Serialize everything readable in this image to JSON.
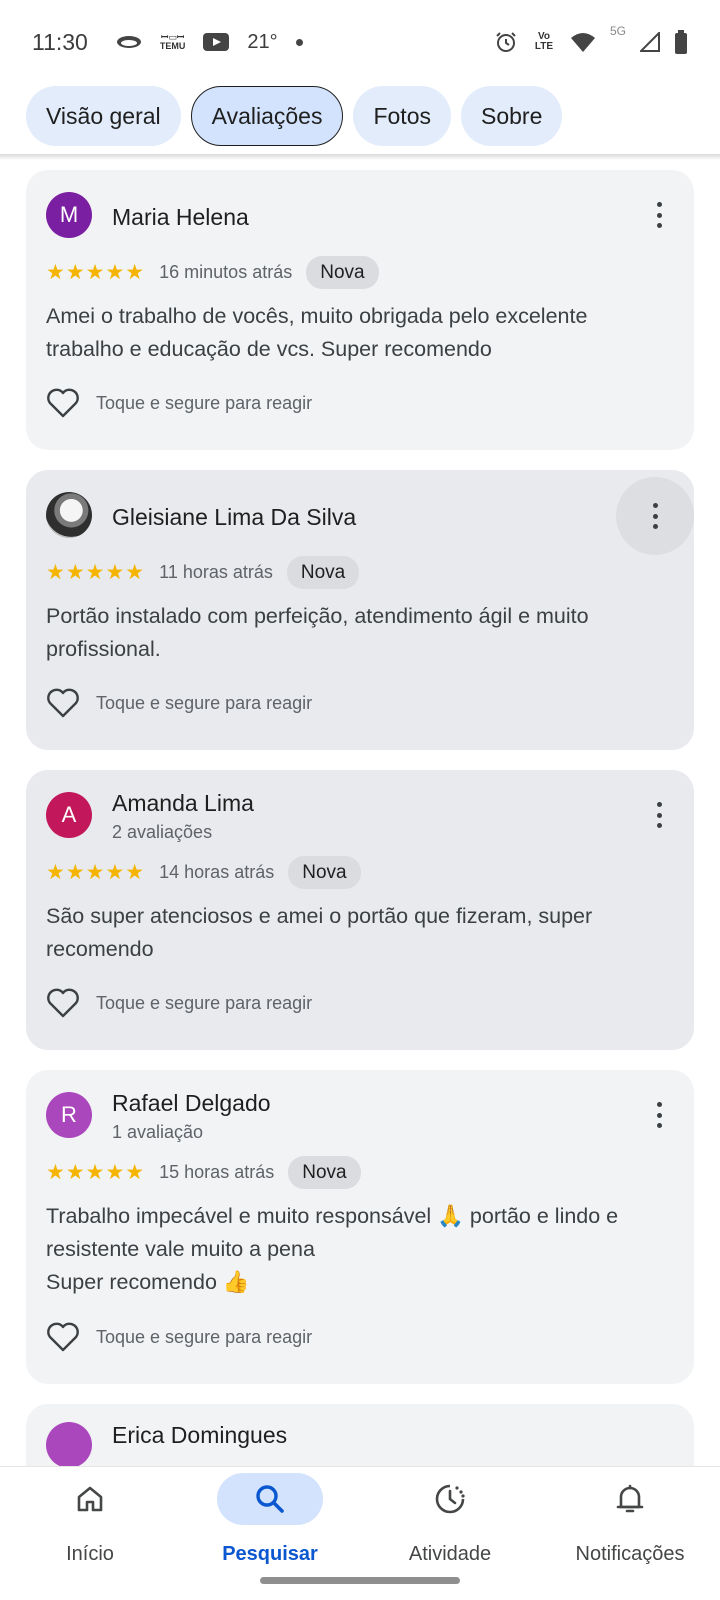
{
  "status_bar": {
    "time": "11:30",
    "temu_label": "TEMU",
    "temperature": "21°",
    "volte_label": "Vo LTE",
    "network_label": "5G"
  },
  "tabs": [
    {
      "label": "Visão geral",
      "active": false
    },
    {
      "label": "Avaliações",
      "active": true
    },
    {
      "label": "Fotos",
      "active": false
    },
    {
      "label": "Sobre",
      "active": false
    }
  ],
  "reviews": [
    {
      "avatar_letter": "M",
      "avatar_color": "#7b1fa2",
      "name": "Maria Helena",
      "review_count": "",
      "rating": 5,
      "stars": "★★★★★",
      "time": "16 minutos atrás",
      "badge": "Nova",
      "text": "Amei o trabalho de vocês, muito obrigada pelo excelente trabalho e educação de vcs. Super recomendo",
      "react_label": "Toque e segure para reagir"
    },
    {
      "avatar_letter": "",
      "avatar_color": "",
      "name": "Gleisiane Lima Da Silva",
      "review_count": "",
      "rating": 5,
      "stars": "★★★★★",
      "time": "11 horas atrás",
      "badge": "Nova",
      "text": "Portão instalado com perfeição, atendimento ágil e muito profissional.",
      "react_label": "Toque e segure para reagir"
    },
    {
      "avatar_letter": "A",
      "avatar_color": "#c2185b",
      "name": "Amanda Lima",
      "review_count": "2 avaliações",
      "rating": 5,
      "stars": "★★★★★",
      "time": "14 horas atrás",
      "badge": "Nova",
      "text": "São super atenciosos e amei o portão que fizeram, super recomendo",
      "react_label": "Toque e segure para reagir"
    },
    {
      "avatar_letter": "R",
      "avatar_color": "#ab47bc",
      "name": "Rafael Delgado",
      "review_count": "1 avaliação",
      "rating": 5,
      "stars": "★★★★★",
      "time": "15 horas atrás",
      "badge": "Nova",
      "text": "Trabalho impecável e muito responsável 🙏 portão e lindo e resistente vale muito a pena\nSuper recomendo 👍",
      "react_label": "Toque e segure para reagir"
    }
  ],
  "partial_review": {
    "name": "Erica Domingues",
    "avatar_color": "#ab47bc"
  },
  "bottom_nav": [
    {
      "label": "Início",
      "icon": "home-icon",
      "active": false
    },
    {
      "label": "Pesquisar",
      "icon": "search-icon",
      "active": true
    },
    {
      "label": "Atividade",
      "icon": "activity-icon",
      "active": false
    },
    {
      "label": "Notificações",
      "icon": "bell-icon",
      "active": false
    }
  ],
  "colors": {
    "accent": "#0b57d0",
    "star": "#f4b400",
    "chip_active": "#d3e3fd"
  }
}
